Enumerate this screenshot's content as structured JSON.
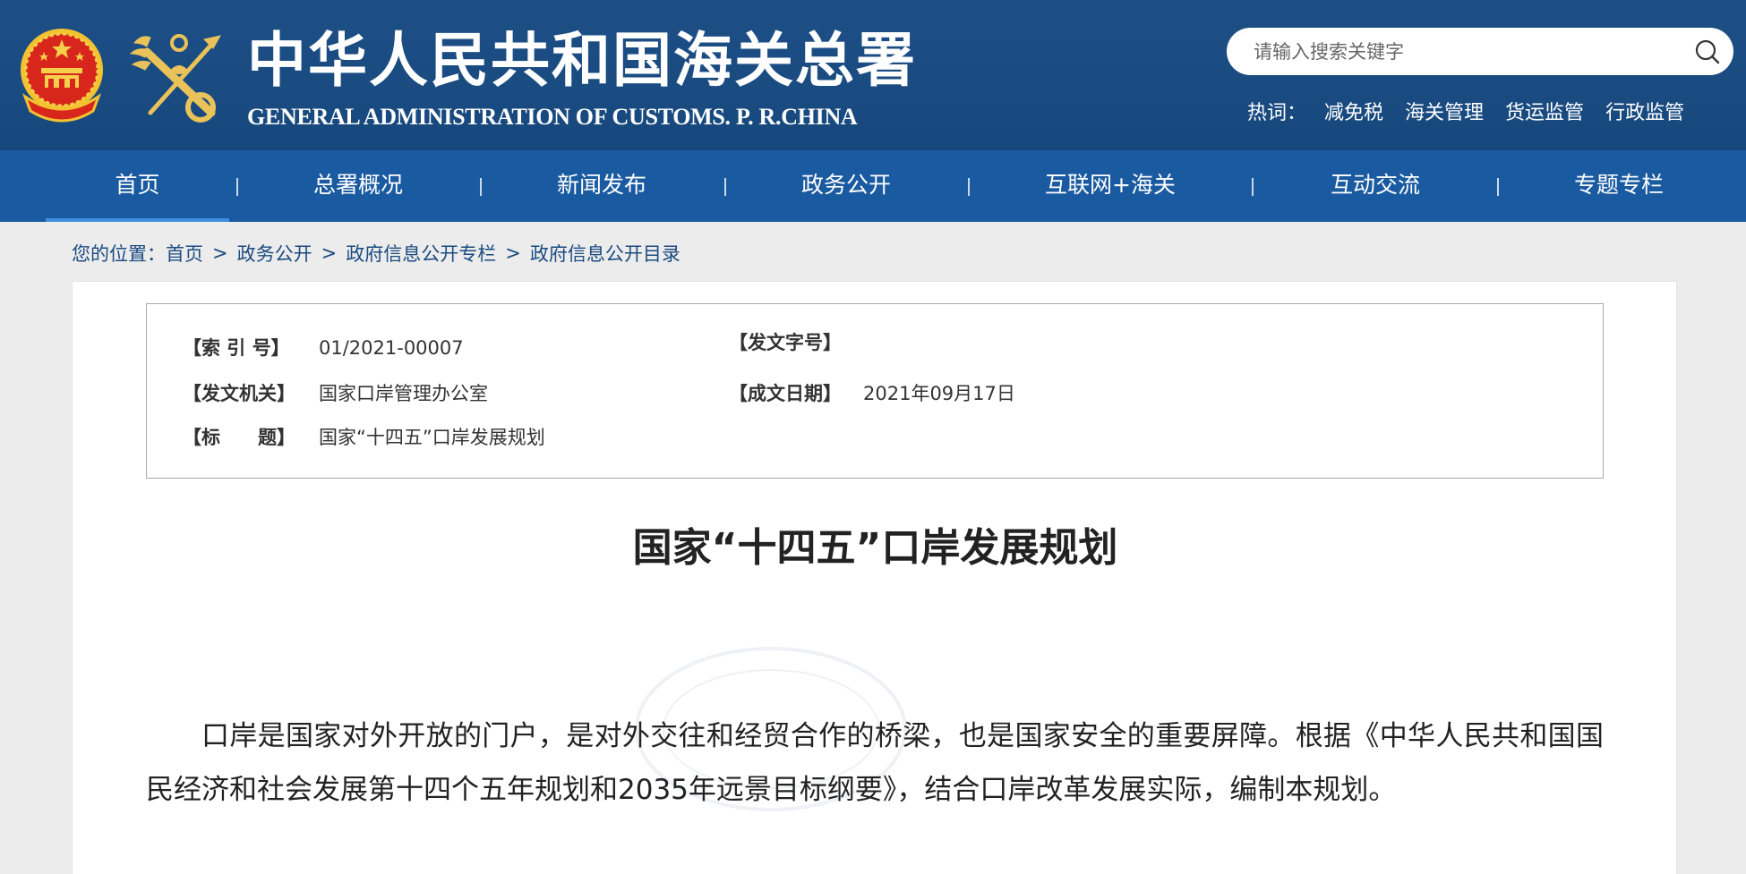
{
  "header": {
    "title_cn": "中华人民共和国海关总署",
    "title_en": "GENERAL ADMINISTRATION OF CUSTOMS. P. R.CHINA",
    "emblem_icon": "national-emblem-icon",
    "logo_icon": "customs-key-logo-icon",
    "search": {
      "placeholder": "请输入搜索关键字",
      "icon": "search-icon"
    },
    "hot": {
      "label": "热词：",
      "words": [
        "减免税",
        "海关管理",
        "货运监管",
        "行政监管"
      ]
    }
  },
  "nav": {
    "items": [
      {
        "label": "首页",
        "active": true
      },
      {
        "label": "总署概况"
      },
      {
        "label": "新闻发布"
      },
      {
        "label": "政务公开"
      },
      {
        "label": "互联网+海关"
      },
      {
        "label": "互动交流"
      },
      {
        "label": "专题专栏"
      }
    ]
  },
  "breadcrumb": {
    "prefix": "您的位置：",
    "items": [
      "首页",
      "政务公开",
      "政府信息公开专栏",
      "政府信息公开目录"
    ],
    "separator": ">"
  },
  "meta": {
    "index_label": "【索 引 号】",
    "index_value": "01/2021-00007",
    "doc_no_label": "【发文字号】",
    "doc_no_value": "",
    "issuer_label": "【发文机关】",
    "issuer_value": "国家口岸管理办公室",
    "date_label": "【成文日期】",
    "date_value": "2021年09月17日",
    "title_label": "【标　　题】",
    "title_value": "国家“十四五”口岸发展规划"
  },
  "article": {
    "title": "国家“十四五”口岸发展规划",
    "paragraph": "口岸是国家对外开放的门户，是对外交往和经贸合作的桥梁，也是国家安全的重要屏障。根据《中华人民共和国国民经济和社会发展第十四个五年规划和2035年远景目标纲要》，结合口岸改革发展实际，编制本规划。"
  },
  "colors": {
    "header_bg": "#1d4f86",
    "nav_bg": "#1a5aa0",
    "nav_active_underline": "#3d8ee0",
    "breadcrumb_text": "#1a4b80"
  }
}
